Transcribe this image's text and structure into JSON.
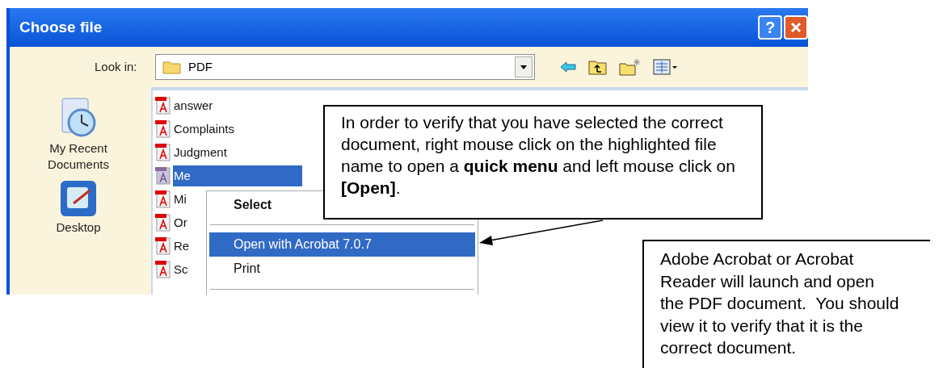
{
  "window": {
    "title": "Choose file",
    "help": "?"
  },
  "look_in": {
    "label": "Look in:",
    "value": "PDF"
  },
  "places": [
    {
      "label": "My Recent Documents",
      "kind": "recent"
    },
    {
      "label": "Desktop",
      "kind": "desktop"
    }
  ],
  "files": [
    {
      "name": "answer",
      "selected": false
    },
    {
      "name": "Complaints",
      "selected": false
    },
    {
      "name": "Judgment",
      "selected": false
    },
    {
      "name": "Me",
      "selected": true
    },
    {
      "name": "Mi",
      "selected": false
    },
    {
      "name": "Or",
      "selected": false
    },
    {
      "name": "Re",
      "selected": false
    },
    {
      "name": "Sc",
      "selected": false
    }
  ],
  "context_menu": [
    {
      "label": "Select",
      "kind": "default",
      "selected": false
    },
    {
      "label": "Open with Acrobat 7.0.7",
      "kind": "item",
      "selected": true
    },
    {
      "label": "Print",
      "kind": "item",
      "selected": false
    }
  ],
  "callouts": [
    "In order to verify that you have selected the correct document, right mouse click on the highlighted file name to open a **quick menu** and left mouse click on **[Open]**.",
    "Adobe Acrobat or Acrobat Reader will launch and open the PDF document.  You should view it to verify that it is the correct document."
  ]
}
